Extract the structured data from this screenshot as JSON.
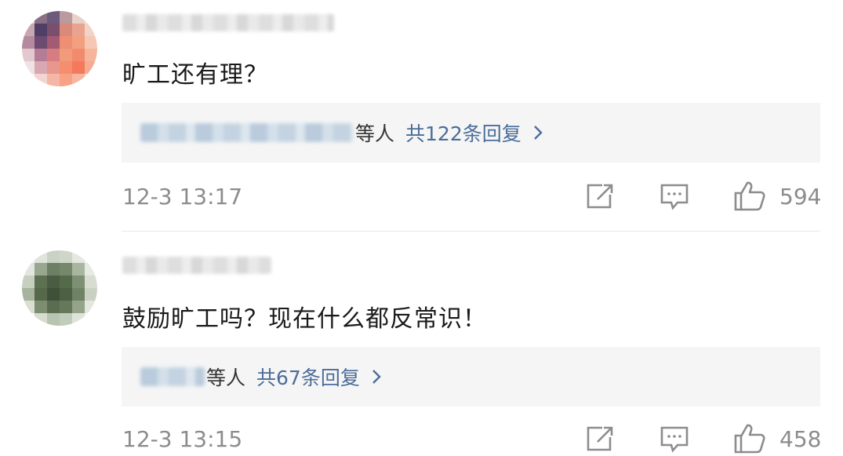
{
  "comments": [
    {
      "text": "旷工还有理？",
      "replies_suffix": "等人",
      "replies_count": "共122条回复",
      "time": "12-3 13:17",
      "likes": "594"
    },
    {
      "text": "鼓励旷工吗？现在什么都反常识！",
      "replies_suffix": "等人",
      "replies_count": "共67条回复",
      "time": "12-3 13:15",
      "likes": "458"
    }
  ],
  "icons": {
    "share": "share-icon",
    "reply": "comment-icon",
    "like": "thumbs-up-icon",
    "chevron": "chevron-right-icon"
  },
  "colors": {
    "link": "#4b6d9a",
    "meta": "#8c8c8c",
    "reply_bg": "#f5f5f5"
  }
}
